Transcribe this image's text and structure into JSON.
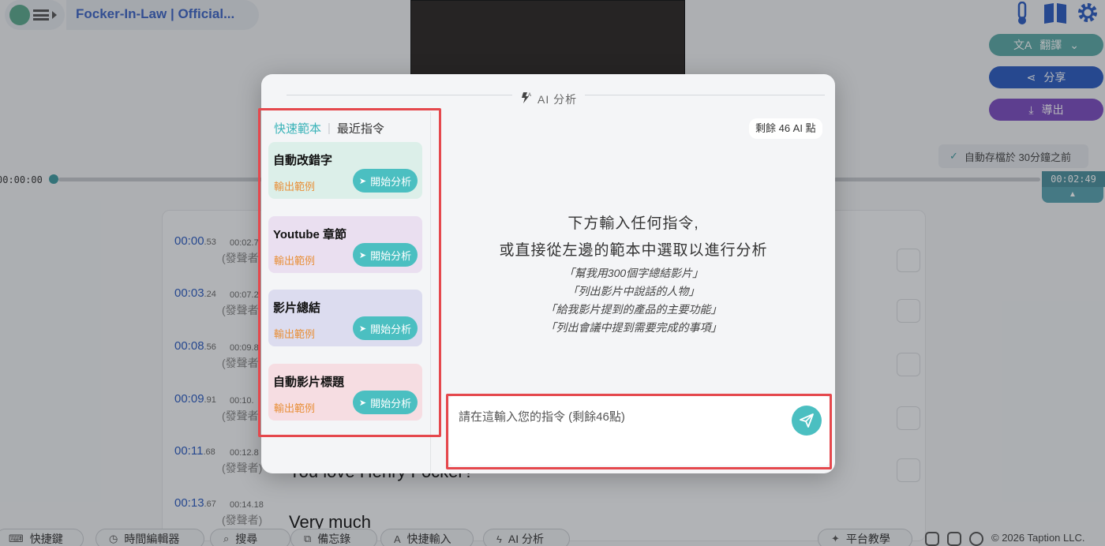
{
  "app": {
    "video_title": "Focker-In-Law | Official...",
    "translate_label": "翻譯",
    "share_label": "分享",
    "export_label": "導出",
    "autosave_text": "自動存檔於 30分鐘之前",
    "time_start": "00:00:00",
    "time_end": "00:02:49",
    "colors": {
      "translate": "#5aa9a6",
      "share": "#2a5ac0",
      "export": "#7b4cc0"
    }
  },
  "transcript": {
    "rows": [
      {
        "start": "00:00",
        "start_ms": ".53",
        "end": "00:02.7",
        "speaker": "(發聲者"
      },
      {
        "start": "00:03",
        "start_ms": ".24",
        "end": "00:07.2",
        "speaker": "(發聲者"
      },
      {
        "start": "00:08",
        "start_ms": ".56",
        "end": "00:09.8",
        "speaker": "(發聲者"
      },
      {
        "start": "00:09",
        "start_ms": ".91",
        "end": "00:10.",
        "speaker": "(發聲者"
      },
      {
        "start": "00:11",
        "start_ms": ".68",
        "end": "00:12.8",
        "speaker": "(發聲者)",
        "text": "You love Henry Focker?"
      },
      {
        "start": "00:13",
        "start_ms": ".67",
        "end": "00:14.18",
        "speaker": "(發聲者)",
        "text": "Very much"
      }
    ]
  },
  "bottom": {
    "shortcuts": "快捷鍵",
    "time_editor": "時間編輯器",
    "search": "搜尋",
    "memo": "備忘錄",
    "quick_input": "快捷輸入",
    "ai_analysis": "AI 分析",
    "tutorial": "平台教學",
    "copyright": "© 2026 Taption LLC."
  },
  "modal": {
    "title": "AI 分析",
    "tabs": {
      "quick": "快速範本",
      "recent": "最近指令"
    },
    "cards": [
      {
        "title": "自動改錯字",
        "example": "輸出範例",
        "button": "開始分析",
        "color": "#dcefe9"
      },
      {
        "title": "Youtube 章節",
        "example": "輸出範例",
        "button": "開始分析",
        "color": "#eadff0"
      },
      {
        "title": "影片總結",
        "example": "輸出範例",
        "button": "開始分析",
        "color": "#dcdcef"
      },
      {
        "title": "自動影片標題",
        "example": "輸出範例",
        "button": "開始分析",
        "color": "#f6dde2"
      }
    ],
    "credits": "剩餘 46 AI 點",
    "hint_line1": "下方輸入任何指令,",
    "hint_line2": "或直接從左邊的範本中選取以進行分析",
    "examples": [
      "「幫我用300個字總結影片」",
      "「列出影片中說話的人物」",
      "「給我影片提到的產品的主要功能」",
      "「列出會議中提到需要完成的事項」"
    ],
    "input_placeholder": "請在這輸入您的指令 (剩餘46點)",
    "input_value": ""
  }
}
